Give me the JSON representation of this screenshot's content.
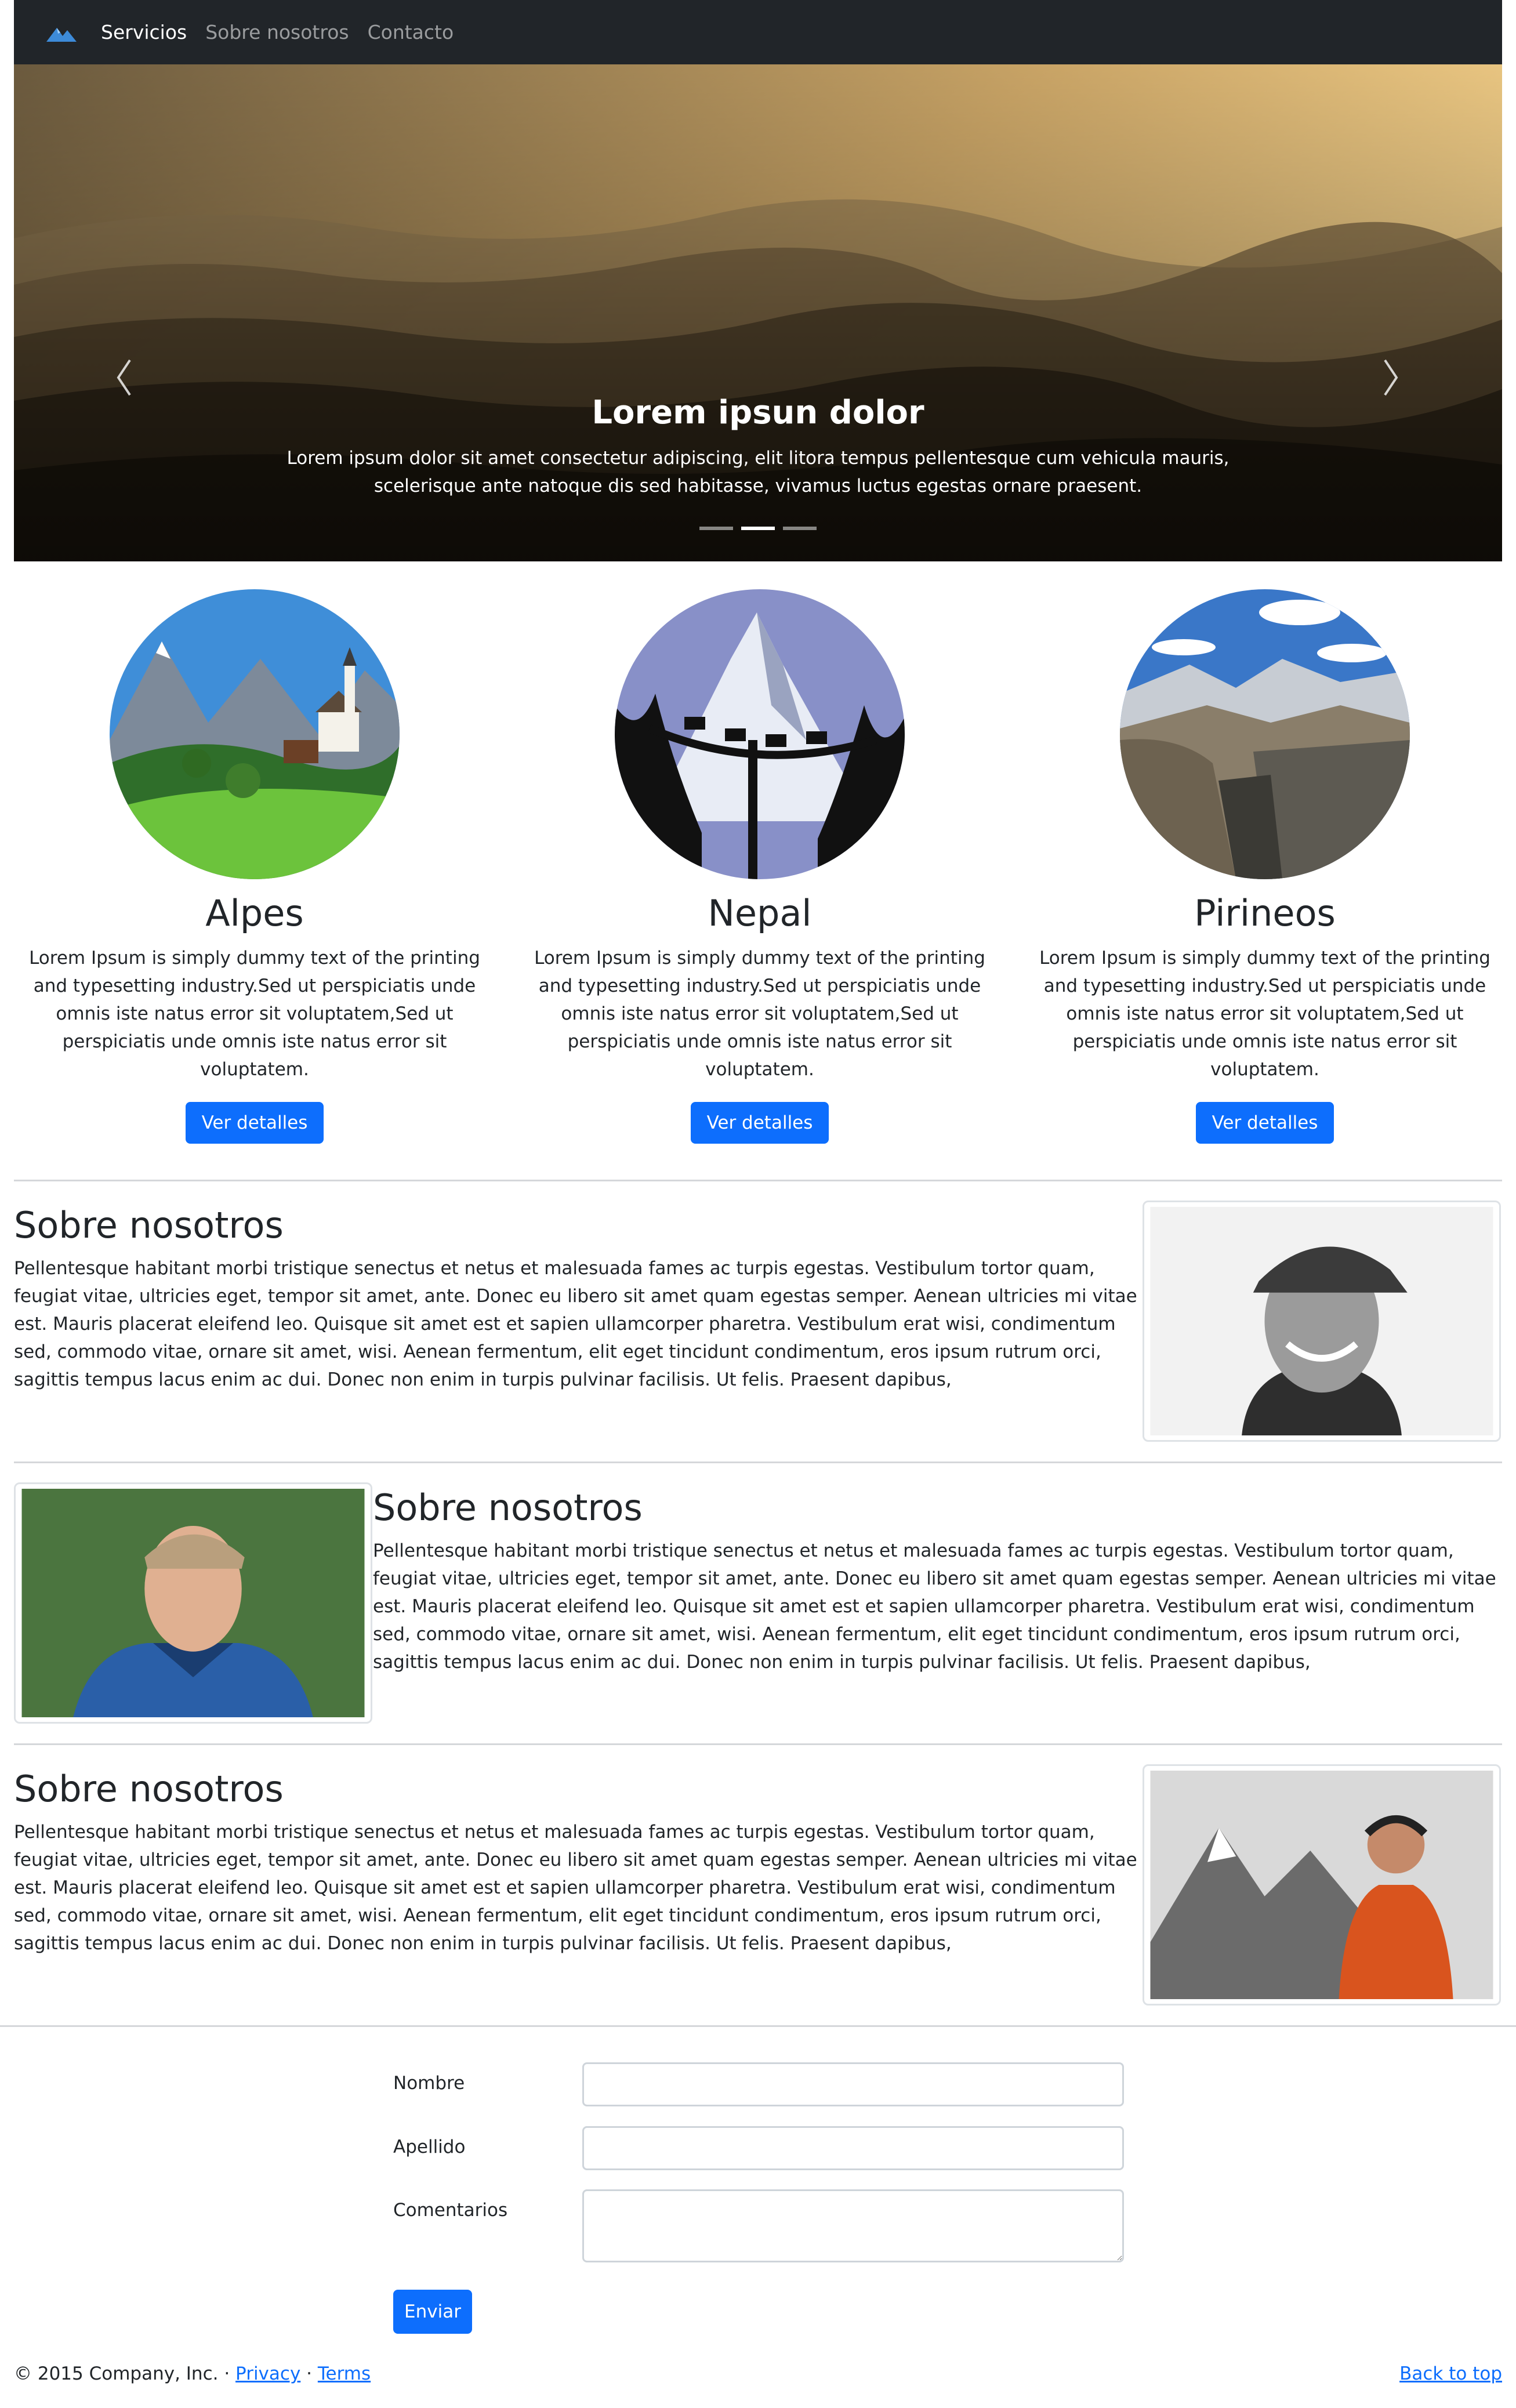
{
  "nav": {
    "brand_icon": "mountain-logo-icon",
    "links": [
      "Servicios",
      "Sobre nosotros",
      "Contacto"
    ]
  },
  "carousel": {
    "title": "Lorem ipsun dolor",
    "text": "Lorem ipsum dolor sit amet consectetur adipiscing, elit litora tempus pellentesque cum vehicula mauris, scelerisque ante natoque dis sed habitasse, vivamus luctus egestas ornare praesent.",
    "prev_icon": "chevron-left-icon",
    "next_icon": "chevron-right-icon",
    "active_slide": 2,
    "slide_count": 3
  },
  "features": [
    {
      "title": "Alpes",
      "text": "Lorem Ipsum is simply dummy text of the printing and typesetting industry.Sed ut perspiciatis unde omnis iste natus error sit voluptatem,Sed ut perspiciatis unde omnis iste natus error sit voluptatem.",
      "button": "Ver detalles"
    },
    {
      "title": "Nepal",
      "text": "Lorem Ipsum is simply dummy text of the printing and typesetting industry.Sed ut perspiciatis unde omnis iste natus error sit voluptatem,Sed ut perspiciatis unde omnis iste natus error sit voluptatem.",
      "button": "Ver detalles"
    },
    {
      "title": "Pirineos",
      "text": "Lorem Ipsum is simply dummy text of the printing and typesetting industry.Sed ut perspiciatis unde omnis iste natus error sit voluptatem,Sed ut perspiciatis unde omnis iste natus error sit voluptatem.",
      "button": "Ver detalles"
    }
  ],
  "about": [
    {
      "title": "Sobre nosotros",
      "text": "Pellentesque habitant morbi tristique senectus et netus et malesuada fames ac turpis egestas. Vestibulum tortor quam, feugiat vitae, ultricies eget, tempor sit amet, ante. Donec eu libero sit amet quam egestas semper. Aenean ultricies mi vitae est. Mauris placerat eleifend leo. Quisque sit amet est et sapien ullamcorper pharetra. Vestibulum erat wisi, condimentum sed, commodo vitae, ornare sit amet, wisi. Aenean fermentum, elit eget tincidunt condimentum, eros ipsum rutrum orci, sagittis tempus lacus enim ac dui. Donec non enim in turpis pulvinar facilisis. Ut felis. Praesent dapibus,"
    },
    {
      "title": "Sobre nosotros",
      "text": "Pellentesque habitant morbi tristique senectus et netus et malesuada fames ac turpis egestas. Vestibulum tortor quam, feugiat vitae, ultricies eget, tempor sit amet, ante. Donec eu libero sit amet quam egestas semper. Aenean ultricies mi vitae est. Mauris placerat eleifend leo. Quisque sit amet est et sapien ullamcorper pharetra. Vestibulum erat wisi, condimentum sed, commodo vitae, ornare sit amet, wisi. Aenean fermentum, elit eget tincidunt condimentum, eros ipsum rutrum orci, sagittis tempus lacus enim ac dui. Donec non enim in turpis pulvinar facilisis. Ut felis. Praesent dapibus,"
    },
    {
      "title": "Sobre nosotros",
      "text": "Pellentesque habitant morbi tristique senectus et netus et malesuada fames ac turpis egestas. Vestibulum tortor quam, feugiat vitae, ultricies eget, tempor sit amet, ante. Donec eu libero sit amet quam egestas semper. Aenean ultricies mi vitae est. Mauris placerat eleifend leo. Quisque sit amet est et sapien ullamcorper pharetra. Vestibulum erat wisi, condimentum sed, commodo vitae, ornare sit amet, wisi. Aenean fermentum, elit eget tincidunt condimentum, eros ipsum rutrum orci, sagittis tempus lacus enim ac dui. Donec non enim in turpis pulvinar facilisis. Ut felis. Praesent dapibus,"
    }
  ],
  "form": {
    "nombre_label": "Nombre",
    "apellido_label": "Apellido",
    "comentarios_label": "Comentarios",
    "submit": "Enviar"
  },
  "footer": {
    "copyright": "© 2015 Company, Inc. · ",
    "privacy": "Privacy",
    "separator": " · ",
    "terms": "Terms",
    "back_to_top": "Back to top"
  },
  "colors": {
    "navbar": "#212529",
    "primary": "#0d6efd",
    "sky": "#f4cf86"
  }
}
